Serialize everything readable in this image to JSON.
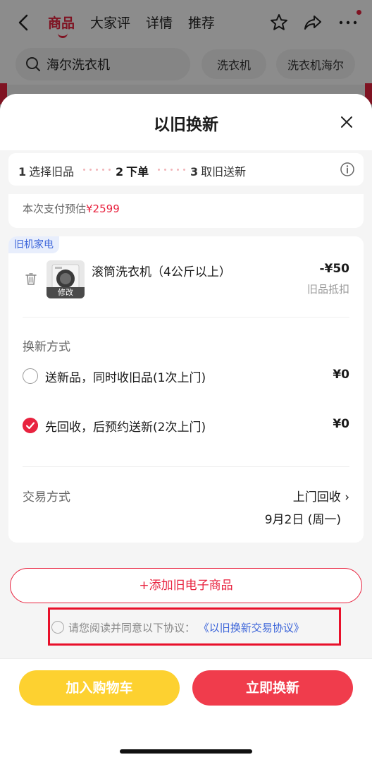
{
  "nav": {
    "tabs": [
      "商品",
      "大家评",
      "详情",
      "推荐"
    ],
    "active_tab": 0
  },
  "search": {
    "query": "海尔洗衣机",
    "chips": [
      "洗衣机",
      "洗衣机海尔"
    ]
  },
  "sheet": {
    "title": "以旧换新",
    "steps": [
      {
        "num": "1",
        "label": "选择旧品"
      },
      {
        "num": "2",
        "label": "下单"
      },
      {
        "num": "3",
        "label": "取旧送新"
      }
    ],
    "active_step": 1,
    "pay_label": "本次支付预估",
    "pay_amount": "¥2599",
    "old_item": {
      "tag": "旧机家电",
      "name": "滚筒洗衣机（4公斤以上）",
      "price": "-¥50",
      "sub": "旧品抵扣",
      "edit_label": "修改"
    },
    "method_label": "换新方式",
    "options": [
      {
        "label": "送新品，同时收旧品(1次上门)",
        "price": "¥0",
        "checked": false
      },
      {
        "label": "先回收，后预约送新(2次上门)",
        "price": "¥0",
        "checked": true
      }
    ],
    "trade_label": "交易方式",
    "trade_value": "上门回收 ›",
    "trade_date": "9月2日 (周一)",
    "add_button": "+添加旧电子商品",
    "agreement_text": "请您阅读并同意以下协议：",
    "agreement_link": "《以旧换新交易协议》",
    "cart_button": "加入购物车",
    "buy_button": "立即换新"
  },
  "colors": {
    "accent_red": "#e8233f",
    "cart_yellow": "#fdd130",
    "link_blue": "#3a63d9"
  }
}
